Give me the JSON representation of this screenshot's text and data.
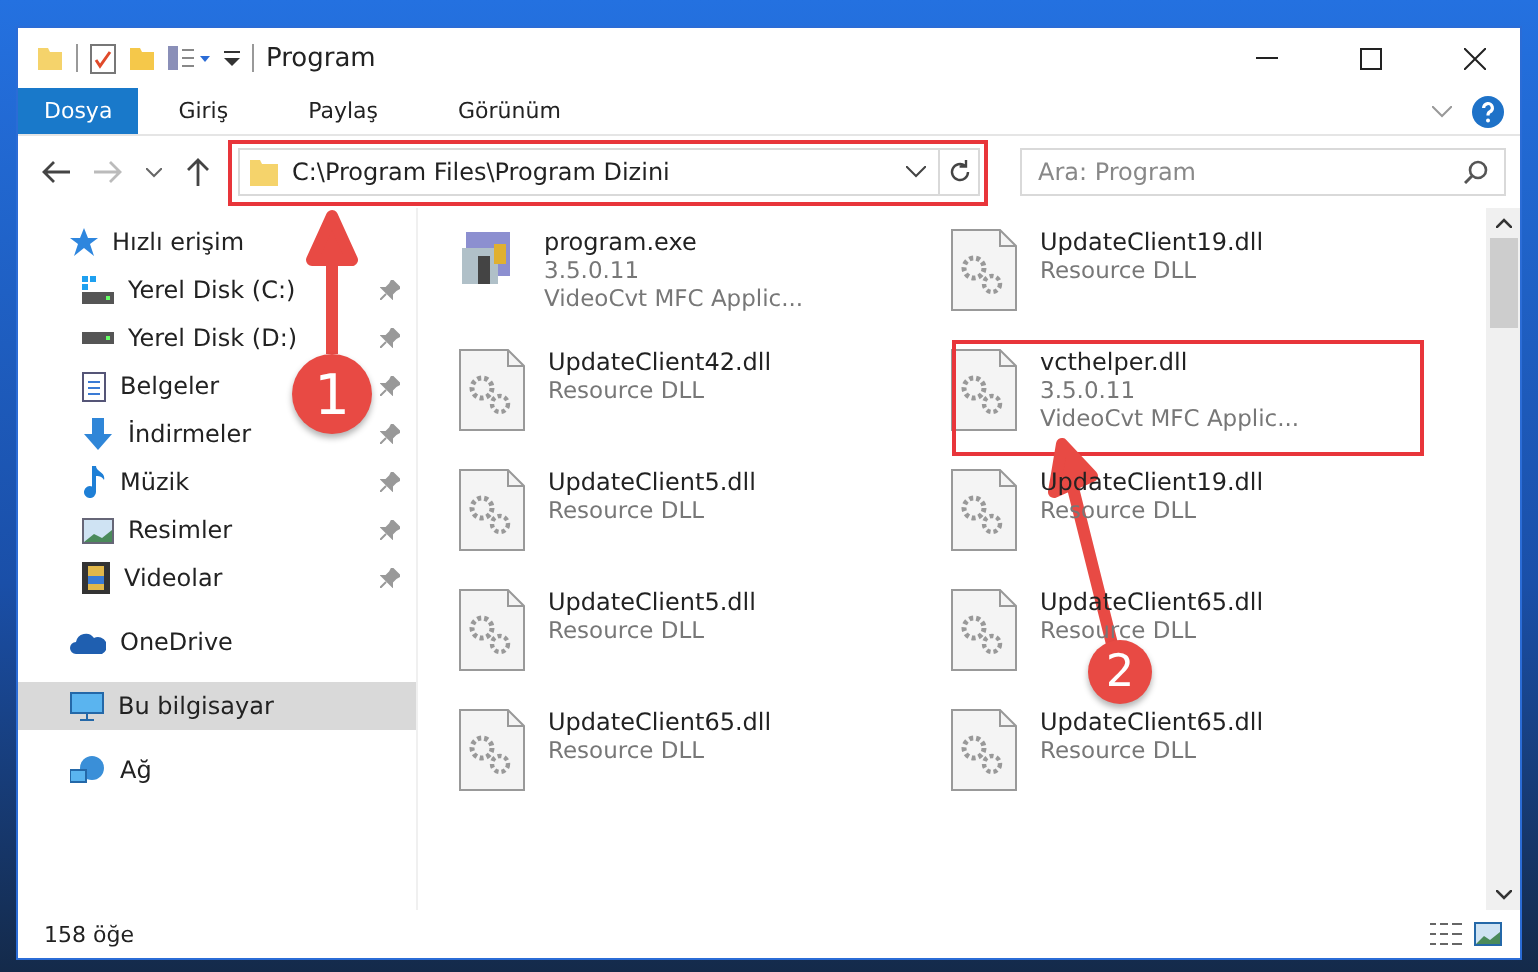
{
  "window": {
    "title": "Program"
  },
  "ribbon_tabs": [
    {
      "label": "Dosya",
      "selected": true
    },
    {
      "label": "Giriş",
      "selected": false
    },
    {
      "label": "Paylaş",
      "selected": false
    },
    {
      "label": "Görünüm",
      "selected": false
    }
  ],
  "address_bar": {
    "path": "C:\\Program Files\\Program Dizini"
  },
  "search": {
    "placeholder": "Ara: Program"
  },
  "sidebar": {
    "items": [
      {
        "label": "Hızlı erişim",
        "kind": "quick",
        "pinned": false,
        "selected": false
      },
      {
        "label": "Yerel Disk (C:)",
        "kind": "disk-c",
        "pinned": true,
        "selected": false
      },
      {
        "label": "Yerel Disk (D:)",
        "kind": "disk",
        "pinned": true,
        "selected": false
      },
      {
        "label": "Belgeler",
        "kind": "documents",
        "pinned": true,
        "selected": false
      },
      {
        "label": "İndirmeler",
        "kind": "downloads",
        "pinned": true,
        "selected": false
      },
      {
        "label": "Müzik",
        "kind": "music",
        "pinned": true,
        "selected": false
      },
      {
        "label": "Resimler",
        "kind": "pictures",
        "pinned": true,
        "selected": false
      },
      {
        "label": "Videolar",
        "kind": "videos",
        "pinned": true,
        "selected": false
      },
      {
        "label": "OneDrive",
        "kind": "cloud",
        "pinned": false,
        "selected": false
      },
      {
        "label": "Bu bilgisayar",
        "kind": "computer",
        "pinned": false,
        "selected": true
      },
      {
        "label": "Ağ",
        "kind": "network",
        "pinned": false,
        "selected": false
      }
    ]
  },
  "files": [
    {
      "name": "program.exe",
      "details": [
        "3.5.0.11",
        "VideoCvt MFC Applic..."
      ],
      "kind": "exe"
    },
    {
      "name": "UpdateClient19.dll",
      "details": [
        "Resource DLL"
      ],
      "kind": "dll"
    },
    {
      "name": "UpdateClient42.dll",
      "details": [
        "Resource DLL"
      ],
      "kind": "dll"
    },
    {
      "name": "vcthelper.dll",
      "details": [
        "3.5.0.11",
        "VideoCvt MFC Applic..."
      ],
      "kind": "dll"
    },
    {
      "name": "UpdateClient5.dll",
      "details": [
        "Resource DLL"
      ],
      "kind": "dll"
    },
    {
      "name": "UpdateClient19.dll",
      "details": [
        "Resource DLL"
      ],
      "kind": "dll"
    },
    {
      "name": "UpdateClient5.dll",
      "details": [
        "Resource DLL"
      ],
      "kind": "dll"
    },
    {
      "name": "UpdateClient65.dll",
      "details": [
        "Resource DLL"
      ],
      "kind": "dll"
    },
    {
      "name": "UpdateClient65.dll",
      "details": [
        "Resource DLL"
      ],
      "kind": "dll"
    },
    {
      "name": "UpdateClient65.dll",
      "details": [
        "Resource DLL"
      ],
      "kind": "dll"
    }
  ],
  "status_bar": {
    "item_count": "158 öğe"
  },
  "annotations": [
    {
      "number": "1"
    },
    {
      "number": "2"
    }
  ]
}
